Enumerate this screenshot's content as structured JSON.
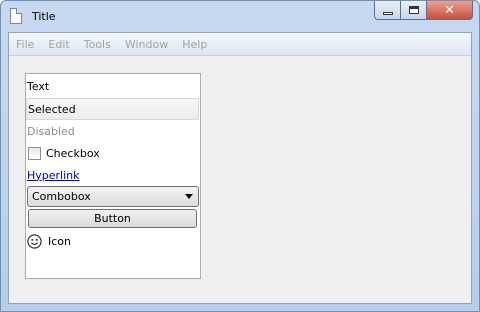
{
  "window": {
    "title": "Title",
    "app_icon": "document-icon",
    "controls": {
      "minimize": "minimize-icon",
      "maximize": "maximize-icon",
      "close": "close-icon",
      "close_glyph": "✕"
    }
  },
  "menubar": {
    "items": [
      {
        "label": "File"
      },
      {
        "label": "Edit"
      },
      {
        "label": "Tools"
      },
      {
        "label": "Window"
      },
      {
        "label": "Help"
      }
    ]
  },
  "panel": {
    "text_item": "Text",
    "selected_item": "Selected",
    "disabled_item": "Disabled",
    "checkbox_label": "Checkbox",
    "checkbox_checked": false,
    "hyperlink_label": "Hyperlink",
    "combobox_value": "Combobox",
    "button_label": "Button",
    "icon_label": "Icon",
    "icon_name": "smiley-icon"
  },
  "colors": {
    "titlebar": "#c7d9f0",
    "close_button": "#c7503b",
    "hyperlink": "#0000cc",
    "disabled_text": "#8d8d8d"
  }
}
